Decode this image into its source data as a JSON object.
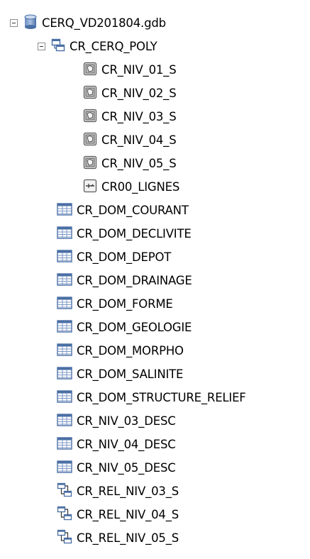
{
  "tree": {
    "root": {
      "label": "CERQ_VD201804.gdb",
      "icon": "geodatabase-icon",
      "expanded": true
    },
    "dataset": {
      "label": "CR_CERQ_POLY",
      "icon": "feature-dataset-icon",
      "expanded": true
    },
    "dataset_children": [
      {
        "label": "CR_NIV_01_S",
        "icon": "polygon-feature-class-icon"
      },
      {
        "label": "CR_NIV_02_S",
        "icon": "polygon-feature-class-icon"
      },
      {
        "label": "CR_NIV_03_S",
        "icon": "polygon-feature-class-icon"
      },
      {
        "label": "CR_NIV_04_S",
        "icon": "polygon-feature-class-icon"
      },
      {
        "label": "CR_NIV_05_S",
        "icon": "polygon-feature-class-icon"
      },
      {
        "label": "CR00_LIGNES",
        "icon": "line-feature-class-icon"
      }
    ],
    "tables": [
      {
        "label": "CR_DOM_COURANT",
        "icon": "table-icon"
      },
      {
        "label": "CR_DOM_DECLIVITE",
        "icon": "table-icon"
      },
      {
        "label": "CR_DOM_DEPOT",
        "icon": "table-icon"
      },
      {
        "label": "CR_DOM_DRAINAGE",
        "icon": "table-icon"
      },
      {
        "label": "CR_DOM_FORME",
        "icon": "table-icon"
      },
      {
        "label": "CR_DOM_GEOLOGIE",
        "icon": "table-icon"
      },
      {
        "label": "CR_DOM_MORPHO",
        "icon": "table-icon"
      },
      {
        "label": "CR_DOM_SALINITE",
        "icon": "table-icon"
      },
      {
        "label": "CR_DOM_STRUCTURE_RELIEF",
        "icon": "table-icon"
      },
      {
        "label": "CR_NIV_03_DESC",
        "icon": "table-icon"
      },
      {
        "label": "CR_NIV_04_DESC",
        "icon": "table-icon"
      },
      {
        "label": "CR_NIV_05_DESC",
        "icon": "table-icon"
      }
    ],
    "relationships": [
      {
        "label": "CR_REL_NIV_03_S",
        "icon": "relationship-class-icon"
      },
      {
        "label": "CR_REL_NIV_04_S",
        "icon": "relationship-class-icon"
      },
      {
        "label": "CR_REL_NIV_05_S",
        "icon": "relationship-class-icon"
      }
    ]
  },
  "colors": {
    "icon_blue": "#4a6fa5",
    "icon_light_blue": "#c9d9ee",
    "icon_border": "#5c5c5c",
    "text": "#000000",
    "background": "#ffffff"
  }
}
